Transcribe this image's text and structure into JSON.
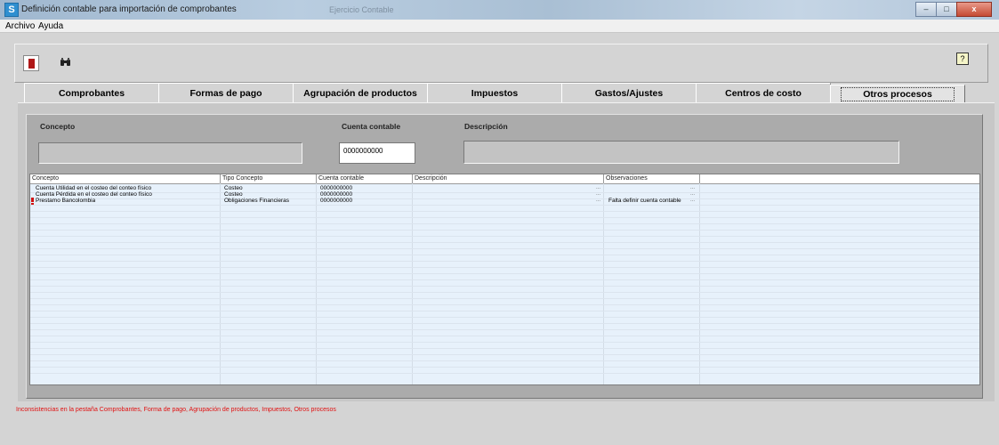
{
  "window": {
    "title": "Definición contable para importación de comprobantes",
    "blurred_title": "Ejercicio Contable",
    "buttons": {
      "minimize": "–",
      "maximize": "□",
      "close": "x"
    }
  },
  "menu": {
    "items": [
      "Archivo",
      "Ayuda"
    ]
  },
  "toolbar": {
    "help_glyph": "?"
  },
  "tabs": [
    "Comprobantes",
    "Formas de pago",
    "Agrupación de productos",
    "Impuestos",
    "Gastos/Ajustes",
    "Centros de costo",
    "Otros procesos"
  ],
  "active_tab_index": 6,
  "form": {
    "concepto_label": "Concepto",
    "cuenta_label": "Cuenta contable",
    "descripcion_label": "Descripción",
    "concepto_value": "",
    "cuenta_value": "0000000000",
    "descripcion_value": ""
  },
  "grid": {
    "columns": [
      "Concepto",
      "Tipo Concepto",
      "Cuenta contable",
      "Descripción",
      "Observaciones"
    ],
    "rows": [
      {
        "concepto": "Cuenta Utilidad en el costeo del conteo físico",
        "tipo": "Costeo",
        "cuenta": "0000000000",
        "descripcion": "",
        "observaciones": "",
        "warning": false
      },
      {
        "concepto": "Cuenta Pérdida en el costeo del conteo físico",
        "tipo": "Costeo",
        "cuenta": "0000000000",
        "descripcion": "",
        "observaciones": "",
        "warning": false
      },
      {
        "concepto": "Prestamo Bancolombia",
        "tipo": "Obligaciones Financieras",
        "cuenta": "0000000000",
        "descripcion": "",
        "observaciones": "Falta definir cuenta contable",
        "warning": true
      }
    ],
    "ellipsis": "..."
  },
  "status": {
    "message": "Inconsistencias en la pestaña Comprobantes, Forma de pago, Agrupación de productos, Impuestos, Otros procesos",
    "color": "#e01010"
  },
  "colors": {
    "grid_bg": "#e7f1fb",
    "warning": "#d01010"
  }
}
